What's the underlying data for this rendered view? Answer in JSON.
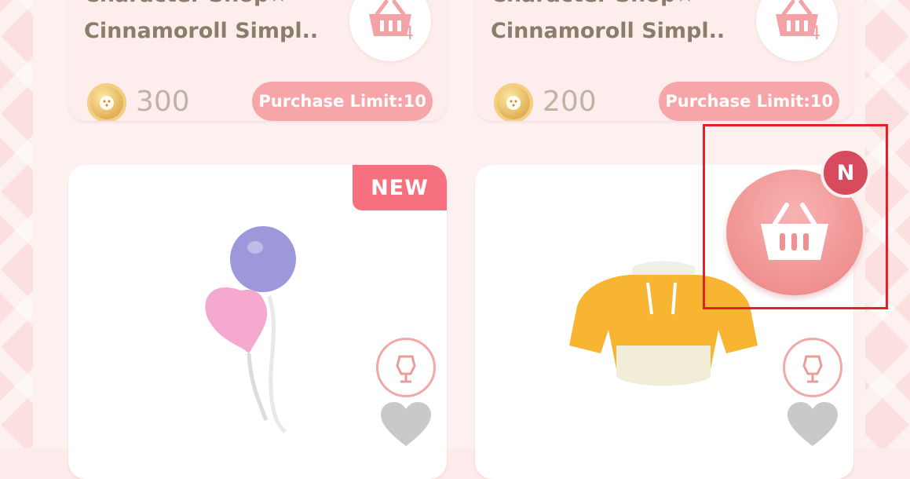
{
  "items_top": [
    {
      "title_line1": "Character Shop★",
      "title_line2": "Cinnamoroll Simpl..",
      "price": "300",
      "purchase_limit": "Purchase Limit:10",
      "cart_count": "4"
    },
    {
      "title_line1": "Character Shop★",
      "title_line2": "Cinnamoroll Simpl..",
      "price": "200",
      "purchase_limit": "Purchase Limit:10",
      "cart_count": "4"
    }
  ],
  "items_bottom": [
    {
      "new_tag": "NEW",
      "image": "balloons-item"
    },
    {
      "image": "yellow-hoodie-item"
    }
  ],
  "floating_cart": {
    "badge": "N",
    "icon": "basket-icon"
  },
  "colors": {
    "accent": "#f09191",
    "badge": "#d84a5d",
    "new_tag": "#f6707f",
    "highlight": "#e32128"
  }
}
